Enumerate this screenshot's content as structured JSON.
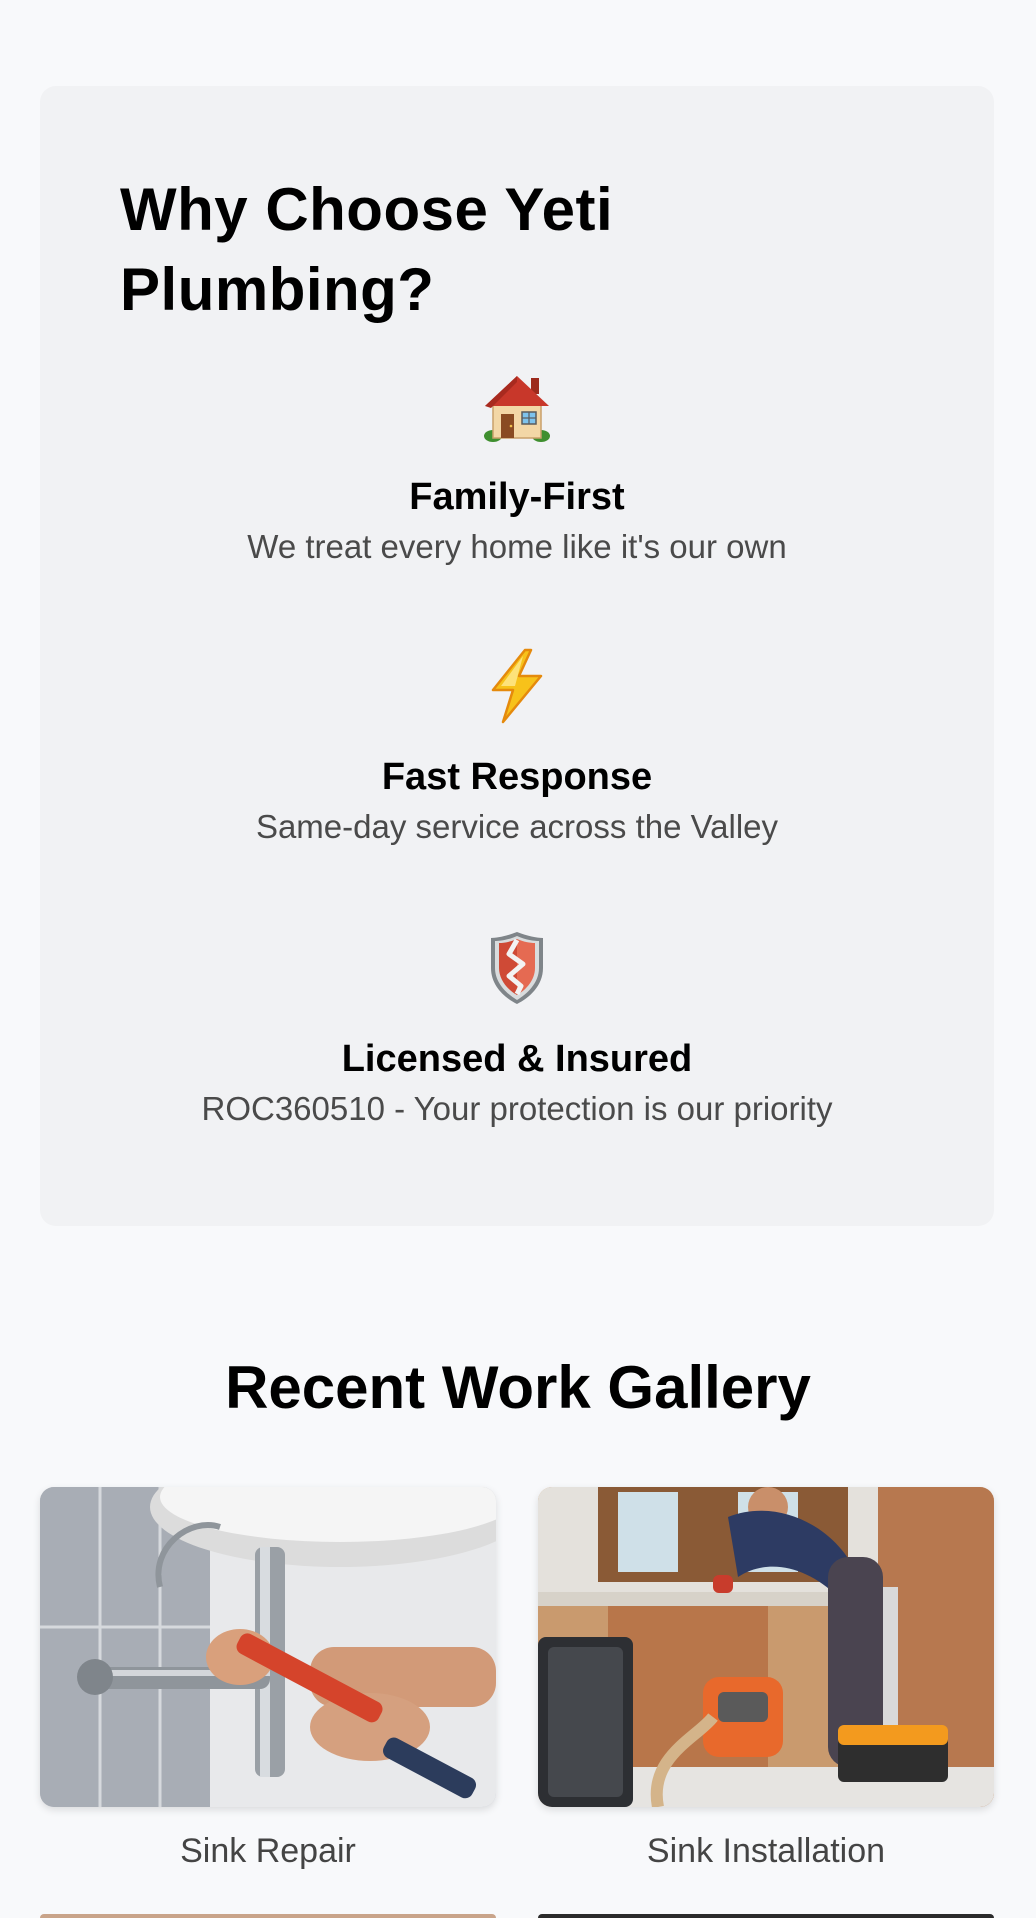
{
  "why_section": {
    "title": "Why Choose Yeti Plumbing?",
    "features": [
      {
        "icon": "house-icon",
        "title": "Family-First",
        "description": "We treat every home like it's our own"
      },
      {
        "icon": "lightning-icon",
        "title": "Fast Response",
        "description": "Same-day service across the Valley"
      },
      {
        "icon": "shield-icon",
        "title": "Licensed & Insured",
        "description": "ROC360510 - Your protection is our priority"
      }
    ]
  },
  "gallery": {
    "title": "Recent Work Gallery",
    "items": [
      {
        "image": "sink-repair-photo",
        "caption": "Sink Repair"
      },
      {
        "image": "sink-installation-photo",
        "caption": "Sink Installation"
      }
    ]
  },
  "colors": {
    "page_background": "#f8f9fb",
    "card_background": "#f1f2f4",
    "description_text": "#4a4a4a",
    "caption_text": "#444444"
  }
}
